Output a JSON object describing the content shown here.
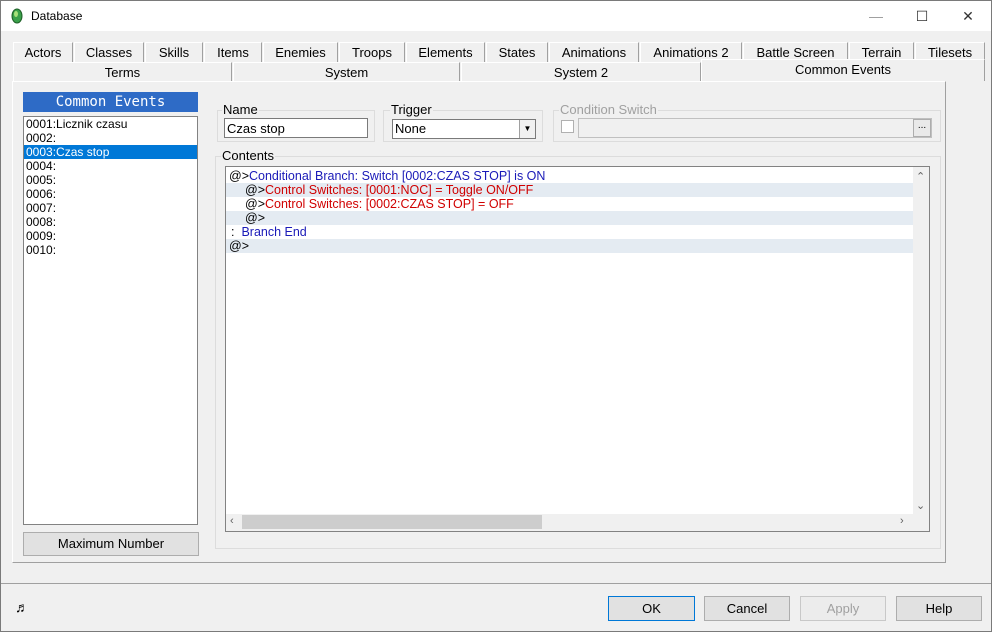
{
  "window": {
    "title": "Database",
    "min_icon": "minimize-icon",
    "max_icon": "maximize-icon",
    "close_icon": "close-icon"
  },
  "tabs_row1": [
    "Actors",
    "Classes",
    "Skills",
    "Items",
    "Enemies",
    "Troops",
    "Elements",
    "States",
    "Animations",
    "Animations 2",
    "Battle Screen",
    "Terrain",
    "Tilesets"
  ],
  "tabs_row2": [
    "Terms",
    "System",
    "System 2",
    "Common Events"
  ],
  "active_tab": "Common Events",
  "list": {
    "header": "Common Events",
    "items": [
      "0001:Licznik czasu",
      "0002:",
      "0003:Czas stop",
      "0004:",
      "0005:",
      "0006:",
      "0007:",
      "0008:",
      "0009:",
      "0010:"
    ],
    "selected_index": 2,
    "max_button": "Maximum Number"
  },
  "name": {
    "label": "Name",
    "value": "Czas stop"
  },
  "trigger": {
    "label": "Trigger",
    "value": "None"
  },
  "condition": {
    "label": "Condition Switch",
    "dots": "..."
  },
  "contents": {
    "label": "Contents",
    "lines": [
      {
        "prefix": "@>",
        "text": "Conditional Branch: Switch [0002:CZAS STOP] is ON",
        "color": "#1a1ab8"
      },
      {
        "prefix": "@>",
        "text": "Control Switches: [0001:NOC] = Toggle ON/OFF",
        "color": "#d00000"
      },
      {
        "prefix": "@>",
        "text": "Control Switches: [0002:CZAS STOP] = OFF",
        "color": "#d00000"
      },
      {
        "prefix": "@>",
        "text": "",
        "color": "#000000"
      },
      {
        "prefix": ":",
        "text": "Branch End",
        "color": "#1a1ab8"
      },
      {
        "prefix": "@>",
        "text": "",
        "color": "#000000"
      }
    ]
  },
  "buttons": {
    "ok": "OK",
    "cancel": "Cancel",
    "apply": "Apply",
    "help": "Help"
  },
  "colors": {
    "selection": "#0078d7",
    "list_header": "#2e6bc6",
    "branch": "#1a1ab8",
    "switch": "#d00000"
  }
}
